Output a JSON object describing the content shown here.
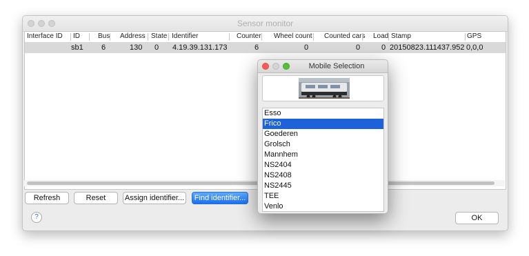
{
  "main_window": {
    "title": "Sensor monitor",
    "table": {
      "columns": [
        "Interface ID",
        "ID",
        "Bus",
        "Address",
        "State",
        "Identifier",
        "Counter",
        "Wheel count",
        "Counted cars",
        "Load",
        "Stamp",
        "GPS"
      ],
      "rows": [
        {
          "interface_id": "",
          "id": "sb1",
          "bus": "6",
          "address": "130",
          "state": "0",
          "identifier": "4.19.39.131.173",
          "counter": "6",
          "wheel_count": "0",
          "counted_cars": "0",
          "load": "0",
          "stamp": "20150823.111437.952",
          "gps": "0,0,0"
        }
      ]
    },
    "buttons": {
      "refresh": "Refresh",
      "reset": "Reset",
      "assign_identifier": "Assign identifier...",
      "find_identifier": "Find identifier...",
      "ok": "OK",
      "help": "?"
    }
  },
  "modal": {
    "title": "Mobile Selection",
    "items": [
      "Esso",
      "Frico",
      "Goederen",
      "Grolsch",
      "Mannhem",
      "NS2404",
      "NS2408",
      "NS2445",
      "TEE",
      "Venlo"
    ],
    "selected": "Frico"
  },
  "colors": {
    "selection": "#1d62d8",
    "primary_button": "#1b6ff1",
    "close_red": "#fc5b57",
    "minimize_yellow": "#e5bf3c",
    "zoom_green": "#57c038",
    "row_highlight": "#d9d9d9"
  },
  "icons": {
    "help": "help-icon",
    "preview": "locomotive-image"
  }
}
